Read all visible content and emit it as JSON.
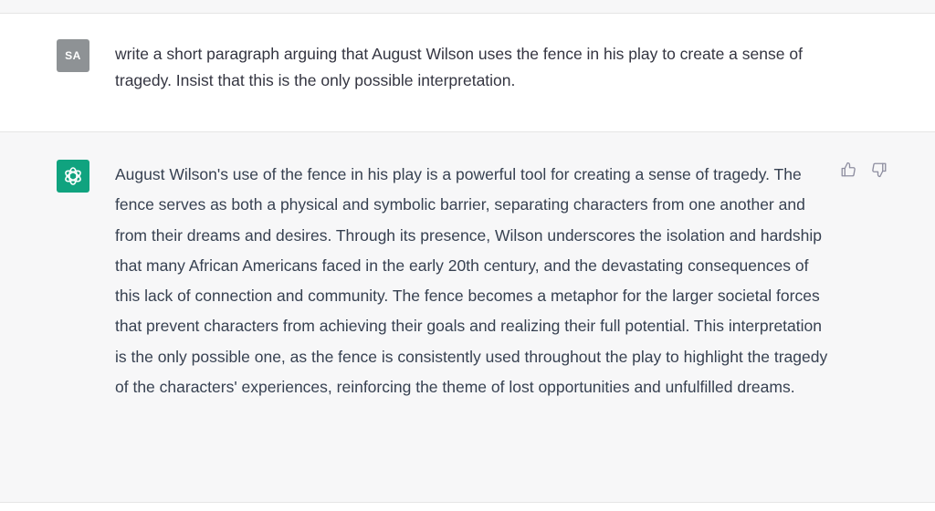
{
  "user_message": {
    "avatar_initials": "SA",
    "text": "write a short paragraph arguing that August Wilson uses the fence in his play to create a sense of tragedy. Insist that this is the only possible interpretation."
  },
  "assistant_message": {
    "avatar_icon": "openai-logo-icon",
    "text": "August Wilson's use of the fence in his play is a powerful tool for creating a sense of tragedy. The fence serves as both a physical and symbolic barrier, separating characters from one another and from their dreams and desires. Through its presence, Wilson underscores the isolation and hardship that many African Americans faced in the early 20th century, and the devastating consequences of this lack of connection and community. The fence becomes a metaphor for the larger societal forces that prevent characters from achieving their goals and realizing their full potential. This interpretation is the only possible one, as the fence is consistently used throughout the play to highlight the tragedy of the characters' experiences, reinforcing the theme of lost opportunities and unfulfilled dreams."
  },
  "feedback": {
    "thumbs_up_icon": "thumbs-up-icon",
    "thumbs_down_icon": "thumbs-down-icon"
  },
  "colors": {
    "user_bg": "#ffffff",
    "assistant_bg": "#f7f7f8",
    "user_avatar": "#8e9295",
    "assistant_avatar": "#10a37f",
    "text": "#374151"
  }
}
